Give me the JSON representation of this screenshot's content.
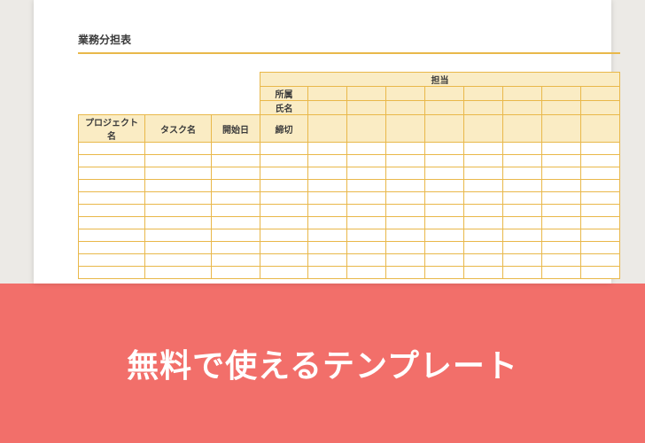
{
  "document": {
    "title": "業務分担表",
    "table": {
      "project_header": "プロジェクト名",
      "task_header": "タスク名",
      "start_header": "開始日",
      "assignee_header": "担当",
      "affiliation_label": "所属",
      "name_label": "氏名",
      "deadline_label": "締切"
    }
  },
  "banner": {
    "text": "無料で使えるテンプレート"
  }
}
